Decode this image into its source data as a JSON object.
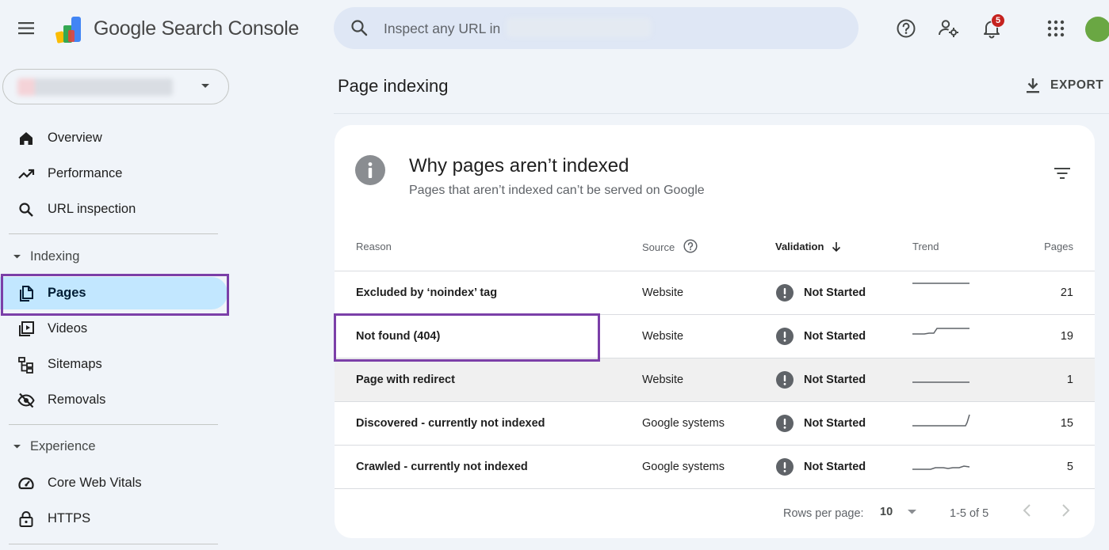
{
  "header": {
    "product_name": "Google Search Console",
    "search_placeholder": "Inspect any URL in",
    "notification_count": "5",
    "icons": [
      "menu-icon",
      "search-console-logo",
      "search-icon",
      "help-icon",
      "admin-settings-icon",
      "notifications-icon",
      "apps-icon"
    ]
  },
  "sidebar": {
    "nav": [
      {
        "label": "Overview",
        "icon": "home-icon"
      },
      {
        "label": "Performance",
        "icon": "trending-up-icon"
      },
      {
        "label": "URL inspection",
        "icon": "search-icon"
      }
    ],
    "sections": [
      {
        "label": "Indexing",
        "items": [
          {
            "label": "Pages",
            "icon": "pages-icon",
            "active": true
          },
          {
            "label": "Videos",
            "icon": "video-library-icon"
          },
          {
            "label": "Sitemaps",
            "icon": "sitemap-icon"
          },
          {
            "label": "Removals",
            "icon": "visibility-off-icon"
          }
        ]
      },
      {
        "label": "Experience",
        "items": [
          {
            "label": "Core Web Vitals",
            "icon": "speed-icon"
          },
          {
            "label": "HTTPS",
            "icon": "lock-icon"
          }
        ]
      }
    ]
  },
  "main": {
    "page_title": "Page indexing",
    "export_label": "EXPORT",
    "card": {
      "title": "Why pages aren’t indexed",
      "subtitle": "Pages that aren’t indexed can’t be served on Google",
      "columns": {
        "reason": "Reason",
        "source": "Source",
        "validation": "Validation",
        "trend": "Trend",
        "pages": "Pages"
      },
      "rows": [
        {
          "reason": "Excluded by ‘noindex’ tag",
          "source": "Website",
          "validation": "Not Started",
          "pages": "21"
        },
        {
          "reason": "Not found (404)",
          "source": "Website",
          "validation": "Not Started",
          "pages": "19"
        },
        {
          "reason": "Page with redirect",
          "source": "Website",
          "validation": "Not Started",
          "pages": "1"
        },
        {
          "reason": "Discovered - currently not indexed",
          "source": "Google systems",
          "validation": "Not Started",
          "pages": "15"
        },
        {
          "reason": "Crawled - currently not indexed",
          "source": "Google systems",
          "validation": "Not Started",
          "pages": "5"
        }
      ],
      "pagination": {
        "rows_per_page_label": "Rows per page:",
        "rows_per_page": "10",
        "range": "1-5 of 5"
      }
    }
  },
  "colors": {
    "page_background": "#f0f4f9",
    "search_background": "#dfe7f5",
    "active_nav": "#c2e7ff",
    "highlight_border": "#7b3fa8",
    "status_icon": "#5f6368",
    "notification_badge": "#c5221f",
    "avatar": "#6aa743"
  }
}
